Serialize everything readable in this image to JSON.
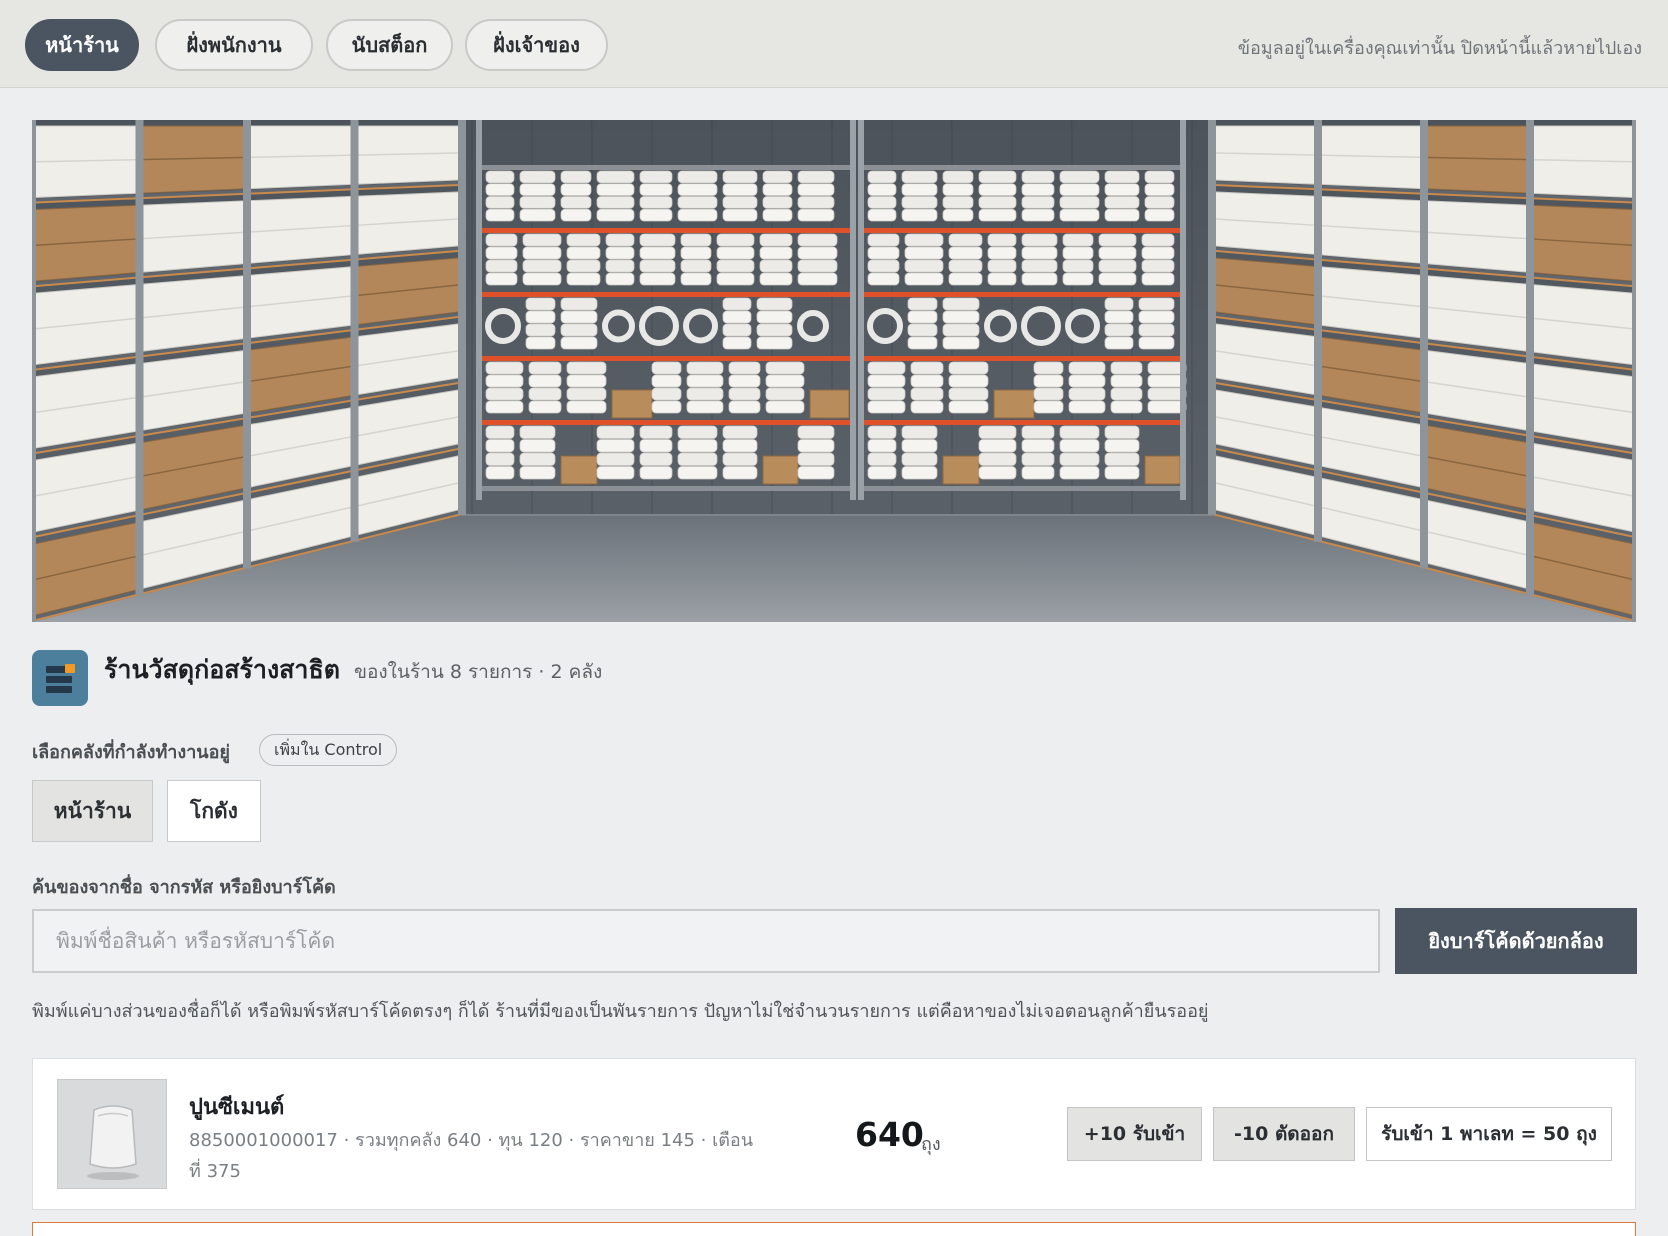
{
  "nav": {
    "tabs": [
      {
        "label": "หน้าร้าน",
        "active": true
      },
      {
        "label": "ฝั่งพนักงาน",
        "active": false
      },
      {
        "label": "นับสต็อก",
        "active": false
      },
      {
        "label": "ฝั่งเจ้าของ",
        "active": false
      }
    ],
    "privacy_note": "ข้อมูลอยู่ในเครื่องคุณเท่านั้น ปิดหน้านี้แล้วหายไปเอง"
  },
  "shop": {
    "name": "ร้านวัสดุก่อสร้างสาธิต",
    "summary": "ของในร้าน 8 รายการ · 2 คลัง"
  },
  "warehouse": {
    "label": "เลือกคลังที่กำลังทำงานอยู่",
    "add_pill": "เพิ่มใน Control",
    "options": [
      {
        "label": "หน้าร้าน",
        "selected": true
      },
      {
        "label": "โกดัง",
        "selected": false
      }
    ]
  },
  "search": {
    "label": "ค้นของจากชื่อ จากรหัส หรือยิงบาร์โค้ด",
    "placeholder": "พิมพ์ชื่อสินค้า หรือรหัสบาร์โค้ด",
    "value": "",
    "scan_button": "ยิงบาร์โค้ดด้วยกล้อง",
    "hint": "พิมพ์แค่บางส่วนของชื่อก็ได้ หรือพิมพ์รหัสบาร์โค้ดตรงๆ ก็ได้ ร้านที่มีของเป็นพันรายการ ปัญหาไม่ใช่จำนวนรายการ แต่คือหาของไม่เจอตอนลูกค้ายืนรออยู่"
  },
  "products": [
    {
      "name": "ปูนซีเมนต์",
      "meta": "8850001000017 · รวมทุกคลัง 640 · ทุน 120 · ราคาขาย 145 · เตือนที่ 375",
      "qty": "640",
      "unit": "ถุง",
      "actions": {
        "receive": "+10 รับเข้า",
        "cut": "-10 ตัดออก",
        "pallet": "รับเข้า 1 พาเลท = 50 ถุง"
      }
    }
  ],
  "colors": {
    "accent": "#4a5561",
    "shelf_beam": "#e0512b",
    "warning_border": "#e07a3a",
    "logo_bg": "#4b7f9b",
    "logo_dot": "#f29a27"
  }
}
